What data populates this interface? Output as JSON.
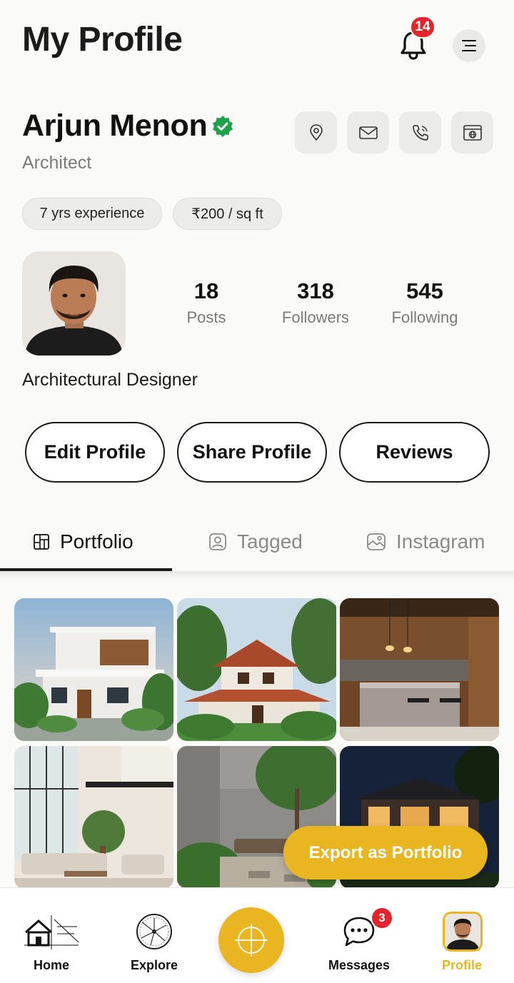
{
  "header": {
    "title": "My Profile",
    "notification_count": "14"
  },
  "profile": {
    "name": "Arjun Menon",
    "role": "Architect",
    "chips": [
      "7 yrs experience",
      "₹200 / sq ft"
    ],
    "bio": "Architectural Designer",
    "stats": [
      {
        "value": "18",
        "label": "Posts"
      },
      {
        "value": "318",
        "label": "Followers"
      },
      {
        "value": "545",
        "label": "Following"
      }
    ]
  },
  "actions": {
    "edit": "Edit Profile",
    "share": "Share Profile",
    "reviews": "Reviews"
  },
  "tabs": [
    {
      "label": "Portfolio",
      "icon": "portfolio-grid-icon"
    },
    {
      "label": "Tagged",
      "icon": "tagged-person-icon"
    },
    {
      "label": "Instagram",
      "icon": "instagram-icon"
    }
  ],
  "export_label": "Export as Portfolio",
  "nav": {
    "home": "Home",
    "explore": "Explore",
    "messages": "Messages",
    "messages_badge": "3",
    "profile": "Profile"
  },
  "colors": {
    "accent": "#e9b520",
    "badge": "#e3242b",
    "verified": "#1fa14a"
  }
}
